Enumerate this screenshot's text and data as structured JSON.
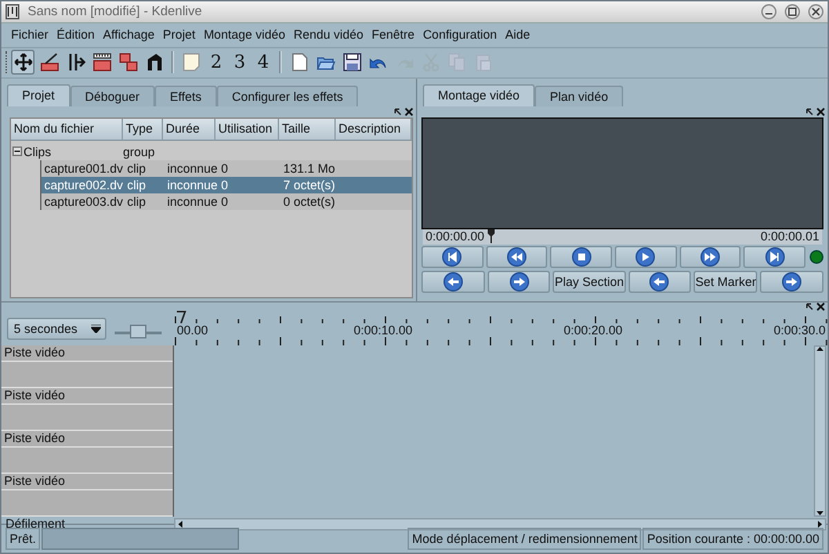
{
  "window": {
    "title": "Sans nom [modifié] - Kdenlive"
  },
  "menu": [
    "Fichier",
    "Édition",
    "Affichage",
    "Projet",
    "Montage vidéo",
    "Rendu vidéo",
    "Fenêtre",
    "Configuration",
    "Aide"
  ],
  "edit_tools": [
    {
      "selected": true
    },
    {
      "selected": false
    },
    {
      "selected": false
    },
    {
      "selected": false
    },
    {
      "selected": false
    },
    {
      "selected": false
    }
  ],
  "track_buttons": [
    "2",
    "3",
    "4"
  ],
  "file_actions": [
    {
      "disabled": false
    },
    {
      "disabled": false
    },
    {
      "disabled": false
    },
    {
      "disabled": false
    },
    {
      "disabled": true
    },
    {
      "disabled": true
    },
    {
      "disabled": true
    },
    {
      "disabled": true
    }
  ],
  "project_tabs": [
    {
      "label": "Projet",
      "selected": true
    },
    {
      "label": "Déboguer",
      "selected": false
    },
    {
      "label": "Effets",
      "selected": false
    },
    {
      "label": "Configurer les effets",
      "selected": false
    }
  ],
  "project_list": {
    "columns": [
      "Nom du fichier",
      "Type",
      "Durée",
      "Utilisation",
      "Taille",
      "Description"
    ],
    "rows": [
      {
        "name": "Clips",
        "type": "group",
        "expanded": true,
        "children": [
          {
            "name": "capture001.dv",
            "type": "clip",
            "duration": "inconnue",
            "usage": "0",
            "size": "131.1 Mo",
            "selected": false
          },
          {
            "name": "capture002.dv",
            "type": "clip",
            "duration": "inconnue",
            "usage": "0",
            "size": "7 octet(s)",
            "selected": true
          },
          {
            "name": "capture003.dv",
            "type": "clip",
            "duration": "inconnue",
            "usage": "0",
            "size": "0 octet(s)",
            "selected": false
          }
        ]
      }
    ]
  },
  "monitor_tabs": [
    {
      "label": "Montage vidéo",
      "selected": true
    },
    {
      "label": "Plan vidéo",
      "selected": false
    }
  ],
  "monitor": {
    "time_start": "0:00:00.00",
    "time_end": "0:00:00.01",
    "controls_row_1": [
      {
        "kind": "icon"
      },
      {
        "kind": "icon"
      },
      {
        "kind": "icon"
      },
      {
        "kind": "icon"
      },
      {
        "kind": "icon"
      },
      {
        "kind": "icon"
      }
    ],
    "controls_row_2": [
      {
        "kind": "icon"
      },
      {
        "kind": "icon"
      },
      {
        "kind": "text",
        "label": "Play Section"
      },
      {
        "kind": "icon"
      },
      {
        "kind": "text",
        "label": "Set Marker"
      },
      {
        "kind": "icon"
      }
    ]
  },
  "timeline": {
    "zoom": "5 secondes",
    "zoom_slider": {
      "level": 0.5
    },
    "ruler_labels": [
      "00.00",
      "0:00:10.00",
      "0:00:20.00",
      "0:00:30.0"
    ],
    "tracks": [
      {
        "name": "Piste vidéo"
      },
      {
        "name": "Piste vidéo"
      },
      {
        "name": "Piste vidéo"
      },
      {
        "name": "Piste vidéo"
      }
    ],
    "scroll_label": "Défilement"
  },
  "status_bar": {
    "message": "Prêt.",
    "mode": "Mode déplacement / redimensionnement",
    "position": "Position courante : 00:00:00.00"
  }
}
